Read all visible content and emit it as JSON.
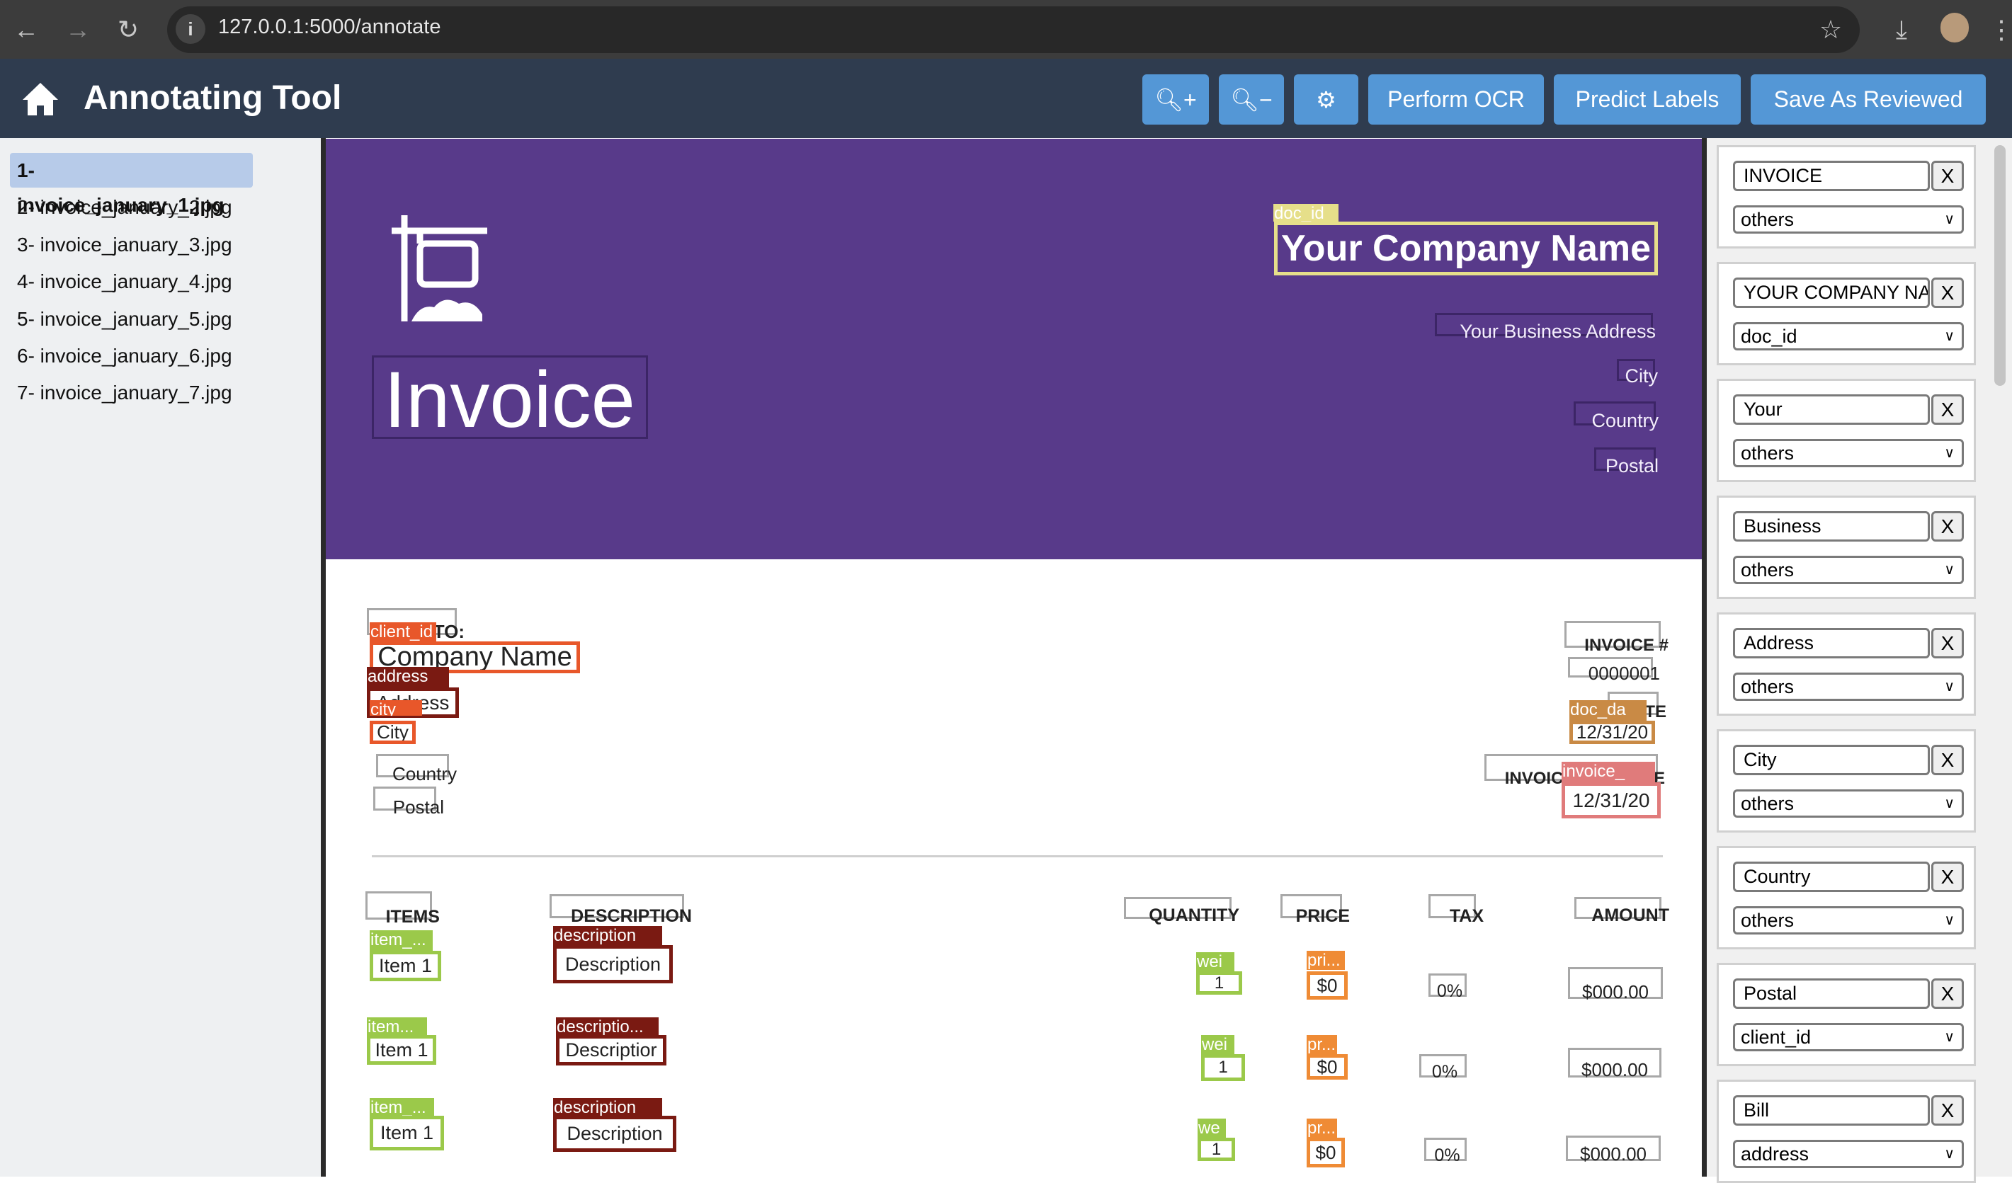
{
  "browser": {
    "url": "127.0.0.1:5000/annotate",
    "icons": [
      "back-arrow-icon",
      "forward-arrow-icon",
      "reload-icon",
      "site-info-icon",
      "star-icon",
      "download-icon",
      "profile-avatar",
      "more-menu-icon"
    ]
  },
  "app": {
    "title": "Annotating Tool",
    "home_icon": "home-icon",
    "toolbar": {
      "zoom_in_icon": "zoom-in-icon",
      "zoom_out_icon": "zoom-out-icon",
      "settings_icon": "gear-icon",
      "perform_ocr": "Perform OCR",
      "predict_labels": "Predict Labels",
      "save_reviewed": "Save As Reviewed"
    },
    "colors": {
      "header": "#2f3c4f",
      "button": "#5497d6",
      "selected_file": "#b7cbe9"
    }
  },
  "files": [
    "1- invoice_january_1.jpg",
    "2- invoice_january_2.jpg",
    "3- invoice_january_3.jpg",
    "4- invoice_january_4.jpg",
    "5- invoice_january_5.jpg",
    "6- invoice_january_6.jpg",
    "7- invoice_january_7.jpg"
  ],
  "selected_file_index": 0,
  "document": {
    "background_color": "#583a8a",
    "logo_title": "Invoice",
    "company_name": "Your Company Name",
    "business_address": "Your Business Address",
    "company_city": "City",
    "company_country": "Country",
    "company_postal": "Postal",
    "bill_to": "BILL TO:",
    "client_name": "Company Name",
    "client_address": "Address",
    "client_city": "City",
    "client_country": "Country",
    "client_postal": "Postal",
    "invoice_no_label": "INVOICE #",
    "invoice_no": "0000001",
    "date_label": "DATE",
    "date": "12/31/20",
    "due_label": "INVOICE DUE DATE",
    "due_date": "12/31/20",
    "headers": {
      "items": "ITEMS",
      "description": "DESCRIPTION",
      "quantity": "QUANTITY",
      "price": "PRICE",
      "tax": "TAX",
      "amount": "AMOUNT"
    },
    "rows": [
      {
        "item": "Item 1",
        "description": "Description",
        "quantity": "1",
        "price": "$0",
        "tax": "0%",
        "amount": "$000.00"
      },
      {
        "item": "Item 1",
        "description": "Descriptior",
        "quantity": "1",
        "price": "$0",
        "tax": "0%",
        "amount": "$000.00"
      },
      {
        "item": "Item 1",
        "description": "Description",
        "quantity": "1",
        "price": "$0",
        "tax": "0%",
        "amount": "$000.00"
      }
    ]
  },
  "annotations": {
    "labels": {
      "doc_id": "doc_id",
      "client_id": "client_id",
      "address": "address",
      "city": "city",
      "doc_date": "doc_da",
      "invoice_due": "invoice_",
      "row_items": [
        "item_...",
        "item...",
        "item_..."
      ],
      "row_desc": [
        "description",
        "descriptio...",
        "description"
      ],
      "row_qty": [
        "wei",
        "wei",
        "we"
      ],
      "row_price": [
        "pri...",
        "pr...",
        "pr..."
      ]
    },
    "colors": {
      "doc_id": "#e6df8a",
      "client_id": "#e8572a",
      "address": "#7a1a12",
      "city": "#e8572a",
      "doc_date": "#c98a45",
      "invoice_due": "#e07b7b",
      "item": "#9bc94a",
      "description": "#7a1a12",
      "quantity": "#9bc94a",
      "price": "#ef8b35"
    }
  },
  "panel": {
    "cards": [
      {
        "text": "INVOICE",
        "label": "others"
      },
      {
        "text": "YOUR COMPANY NA",
        "label": "doc_id"
      },
      {
        "text": "Your",
        "label": "others"
      },
      {
        "text": "Business",
        "label": "others"
      },
      {
        "text": "Address",
        "label": "others"
      },
      {
        "text": "City",
        "label": "others"
      },
      {
        "text": "Country",
        "label": "others"
      },
      {
        "text": "Postal",
        "label": "client_id"
      },
      {
        "text": "Bill",
        "label": "address"
      }
    ],
    "remove_label": "X"
  }
}
